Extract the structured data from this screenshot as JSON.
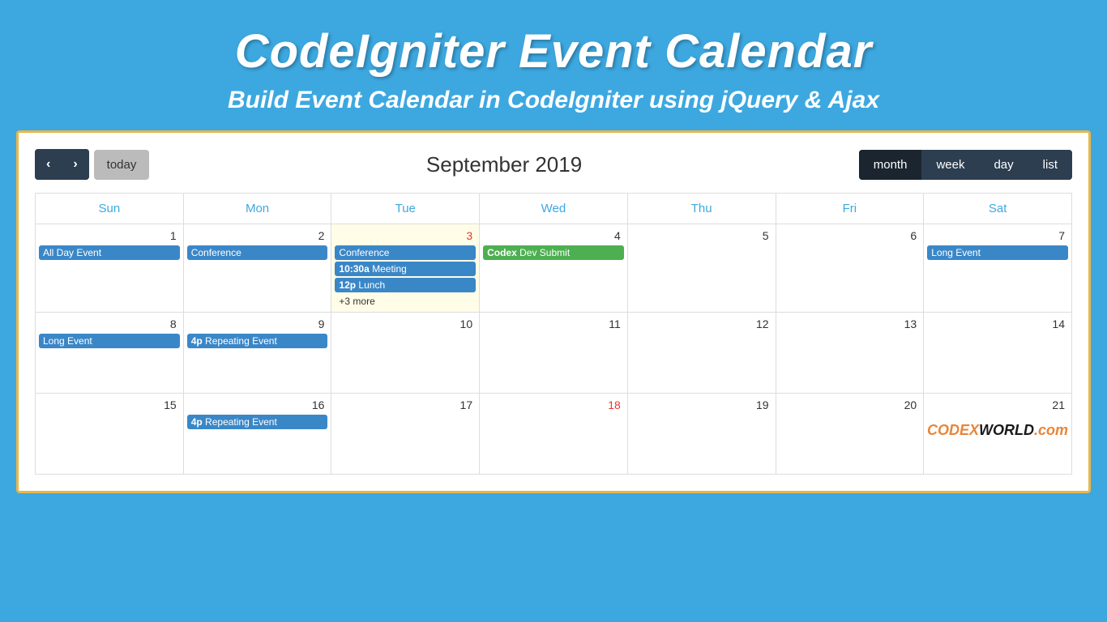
{
  "header": {
    "title": "CodeIgniter Event Calendar",
    "subtitle": "Build Event Calendar in CodeIgniter using jQuery & Ajax"
  },
  "toolbar": {
    "prev_label": "‹",
    "next_label": "›",
    "today_label": "today",
    "current_month": "September 2019",
    "views": [
      "month",
      "week",
      "day",
      "list"
    ],
    "active_view": "month"
  },
  "days": [
    "Sun",
    "Mon",
    "Tue",
    "Wed",
    "Thu",
    "Fri",
    "Sat"
  ],
  "weeks": [
    {
      "days": [
        {
          "num": "1",
          "events": [
            {
              "label": "All Day Event",
              "color": "blue",
              "allday": true
            }
          ]
        },
        {
          "num": "2",
          "events": [
            {
              "label": "Conference",
              "color": "blue",
              "allday": true
            }
          ]
        },
        {
          "num": "3",
          "today": true,
          "events": [
            {
              "label": "Conference",
              "color": "blue",
              "allday": true
            },
            {
              "label": "10:30a Meeting",
              "color": "blue",
              "time": "10:30a",
              "name": "Meeting"
            },
            {
              "label": "12p Lunch",
              "color": "blue",
              "time": "12p",
              "name": "Lunch"
            },
            {
              "label": "+3 more",
              "color": "none"
            }
          ]
        },
        {
          "num": "4",
          "events": [
            {
              "label": "Codex Dev Submit",
              "color": "green",
              "bold_part": "Codex"
            }
          ]
        },
        {
          "num": "5",
          "events": []
        },
        {
          "num": "6",
          "events": []
        },
        {
          "num": "7",
          "events": [
            {
              "label": "Long Event",
              "color": "blue",
              "allday": true
            }
          ]
        }
      ]
    },
    {
      "days": [
        {
          "num": "8",
          "events": [
            {
              "label": "Long Event",
              "color": "blue",
              "allday": true
            }
          ]
        },
        {
          "num": "9",
          "events": [
            {
              "label": "4p Repeating Event",
              "color": "blue",
              "time": "4p",
              "name": "Repeating Event"
            }
          ]
        },
        {
          "num": "10",
          "events": []
        },
        {
          "num": "11",
          "events": []
        },
        {
          "num": "12",
          "events": []
        },
        {
          "num": "13",
          "events": []
        },
        {
          "num": "14",
          "events": []
        }
      ]
    },
    {
      "days": [
        {
          "num": "15",
          "events": []
        },
        {
          "num": "16",
          "events": [
            {
              "label": "4p Repeating Event",
              "color": "blue",
              "time": "4p",
              "name": "Repeating Event"
            }
          ]
        },
        {
          "num": "17",
          "events": []
        },
        {
          "num": "18",
          "events": []
        },
        {
          "num": "19",
          "events": []
        },
        {
          "num": "20",
          "events": []
        },
        {
          "num": "21",
          "events": []
        }
      ]
    }
  ],
  "watermark": {
    "codex": "CODEX",
    "world": "WORLD",
    "dot_com": ".com"
  }
}
